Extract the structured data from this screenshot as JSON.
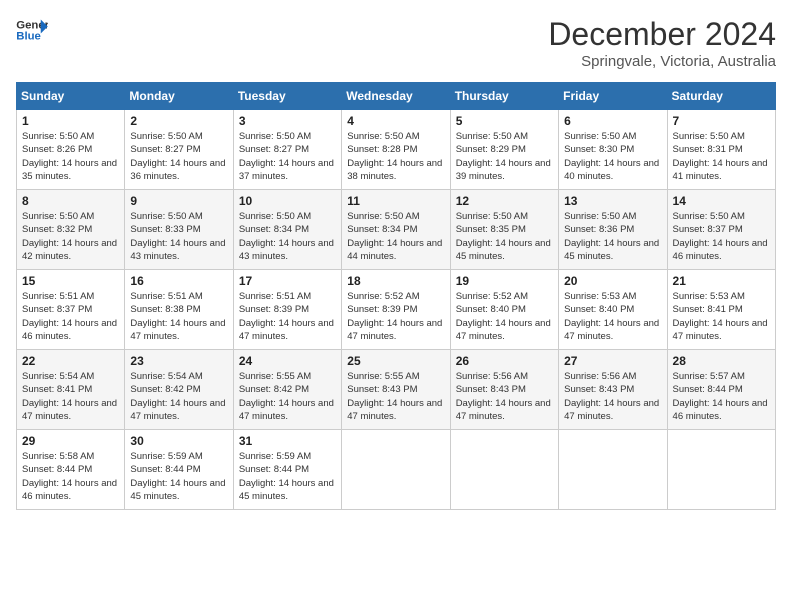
{
  "header": {
    "logo_line1": "General",
    "logo_line2": "Blue",
    "month": "December 2024",
    "location": "Springvale, Victoria, Australia"
  },
  "days_of_week": [
    "Sunday",
    "Monday",
    "Tuesday",
    "Wednesday",
    "Thursday",
    "Friday",
    "Saturday"
  ],
  "weeks": [
    [
      {
        "day": "1",
        "sunrise": "5:50 AM",
        "sunset": "8:26 PM",
        "daylight": "14 hours and 35 minutes."
      },
      {
        "day": "2",
        "sunrise": "5:50 AM",
        "sunset": "8:27 PM",
        "daylight": "14 hours and 36 minutes."
      },
      {
        "day": "3",
        "sunrise": "5:50 AM",
        "sunset": "8:27 PM",
        "daylight": "14 hours and 37 minutes."
      },
      {
        "day": "4",
        "sunrise": "5:50 AM",
        "sunset": "8:28 PM",
        "daylight": "14 hours and 38 minutes."
      },
      {
        "day": "5",
        "sunrise": "5:50 AM",
        "sunset": "8:29 PM",
        "daylight": "14 hours and 39 minutes."
      },
      {
        "day": "6",
        "sunrise": "5:50 AM",
        "sunset": "8:30 PM",
        "daylight": "14 hours and 40 minutes."
      },
      {
        "day": "7",
        "sunrise": "5:50 AM",
        "sunset": "8:31 PM",
        "daylight": "14 hours and 41 minutes."
      }
    ],
    [
      {
        "day": "8",
        "sunrise": "5:50 AM",
        "sunset": "8:32 PM",
        "daylight": "14 hours and 42 minutes."
      },
      {
        "day": "9",
        "sunrise": "5:50 AM",
        "sunset": "8:33 PM",
        "daylight": "14 hours and 43 minutes."
      },
      {
        "day": "10",
        "sunrise": "5:50 AM",
        "sunset": "8:34 PM",
        "daylight": "14 hours and 43 minutes."
      },
      {
        "day": "11",
        "sunrise": "5:50 AM",
        "sunset": "8:34 PM",
        "daylight": "14 hours and 44 minutes."
      },
      {
        "day": "12",
        "sunrise": "5:50 AM",
        "sunset": "8:35 PM",
        "daylight": "14 hours and 45 minutes."
      },
      {
        "day": "13",
        "sunrise": "5:50 AM",
        "sunset": "8:36 PM",
        "daylight": "14 hours and 45 minutes."
      },
      {
        "day": "14",
        "sunrise": "5:50 AM",
        "sunset": "8:37 PM",
        "daylight": "14 hours and 46 minutes."
      }
    ],
    [
      {
        "day": "15",
        "sunrise": "5:51 AM",
        "sunset": "8:37 PM",
        "daylight": "14 hours and 46 minutes."
      },
      {
        "day": "16",
        "sunrise": "5:51 AM",
        "sunset": "8:38 PM",
        "daylight": "14 hours and 47 minutes."
      },
      {
        "day": "17",
        "sunrise": "5:51 AM",
        "sunset": "8:39 PM",
        "daylight": "14 hours and 47 minutes."
      },
      {
        "day": "18",
        "sunrise": "5:52 AM",
        "sunset": "8:39 PM",
        "daylight": "14 hours and 47 minutes."
      },
      {
        "day": "19",
        "sunrise": "5:52 AM",
        "sunset": "8:40 PM",
        "daylight": "14 hours and 47 minutes."
      },
      {
        "day": "20",
        "sunrise": "5:53 AM",
        "sunset": "8:40 PM",
        "daylight": "14 hours and 47 minutes."
      },
      {
        "day": "21",
        "sunrise": "5:53 AM",
        "sunset": "8:41 PM",
        "daylight": "14 hours and 47 minutes."
      }
    ],
    [
      {
        "day": "22",
        "sunrise": "5:54 AM",
        "sunset": "8:41 PM",
        "daylight": "14 hours and 47 minutes."
      },
      {
        "day": "23",
        "sunrise": "5:54 AM",
        "sunset": "8:42 PM",
        "daylight": "14 hours and 47 minutes."
      },
      {
        "day": "24",
        "sunrise": "5:55 AM",
        "sunset": "8:42 PM",
        "daylight": "14 hours and 47 minutes."
      },
      {
        "day": "25",
        "sunrise": "5:55 AM",
        "sunset": "8:43 PM",
        "daylight": "14 hours and 47 minutes."
      },
      {
        "day": "26",
        "sunrise": "5:56 AM",
        "sunset": "8:43 PM",
        "daylight": "14 hours and 47 minutes."
      },
      {
        "day": "27",
        "sunrise": "5:56 AM",
        "sunset": "8:43 PM",
        "daylight": "14 hours and 47 minutes."
      },
      {
        "day": "28",
        "sunrise": "5:57 AM",
        "sunset": "8:44 PM",
        "daylight": "14 hours and 46 minutes."
      }
    ],
    [
      {
        "day": "29",
        "sunrise": "5:58 AM",
        "sunset": "8:44 PM",
        "daylight": "14 hours and 46 minutes."
      },
      {
        "day": "30",
        "sunrise": "5:59 AM",
        "sunset": "8:44 PM",
        "daylight": "14 hours and 45 minutes."
      },
      {
        "day": "31",
        "sunrise": "5:59 AM",
        "sunset": "8:44 PM",
        "daylight": "14 hours and 45 minutes."
      },
      null,
      null,
      null,
      null
    ]
  ]
}
